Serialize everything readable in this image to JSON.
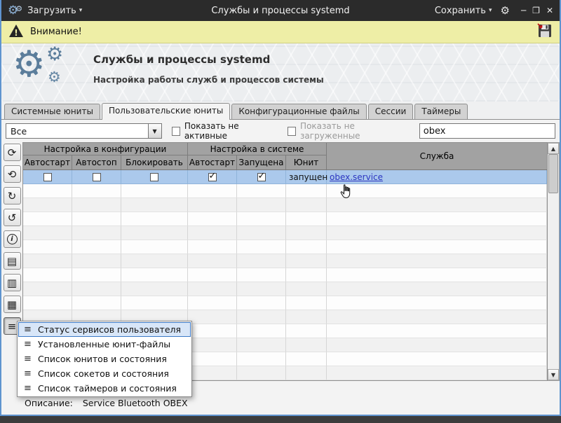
{
  "titlebar": {
    "app_icon": "⚙",
    "load_button": "Загрузить",
    "dropdown_arrow": "▾",
    "title": "Службы и процессы systemd",
    "save_button": "Сохранить",
    "settings_icon": "⚙",
    "minimize_icon": "─",
    "maximize_icon": "❐",
    "close_icon": "✕"
  },
  "warning_bar": {
    "text": "Внимание!"
  },
  "header": {
    "gear_icon": "⚙",
    "title": "Службы и процессы systemd",
    "subtitle": "Настройка работы служб и процессов системы"
  },
  "tabs": [
    {
      "label": "Системные юниты"
    },
    {
      "label": "Пользовательские юниты"
    },
    {
      "label": "Конфигурационные файлы"
    },
    {
      "label": "Сессии"
    },
    {
      "label": "Таймеры"
    }
  ],
  "filter_bar": {
    "unit_filter_value": "Все",
    "dropdown_arrow": "▼",
    "show_inactive_label": "Показать не активные",
    "show_unloaded_label": "Показать не загруженные",
    "search_value": "obex"
  },
  "toolbar": {
    "buttons": [
      {
        "name": "refresh",
        "glyph": "⟳"
      },
      {
        "name": "refresh-all",
        "glyph": "⟲"
      },
      {
        "name": "redo",
        "glyph": "↻"
      },
      {
        "name": "undo",
        "glyph": "↺"
      },
      {
        "name": "info",
        "glyph": "i"
      },
      {
        "name": "file",
        "glyph": "▤"
      },
      {
        "name": "journal",
        "glyph": "▥"
      },
      {
        "name": "list",
        "glyph": "▦"
      },
      {
        "name": "status-menu",
        "glyph": "≡"
      }
    ]
  },
  "table": {
    "group_config": "Настройка в конфигурации",
    "group_system": "Настройка в системе",
    "col_service": "Служба",
    "columns": [
      "Автостарт",
      "Автостоп",
      "Блокировать",
      "Автостарт",
      "Запущена",
      "Юнит"
    ],
    "row": {
      "config_autostart": false,
      "config_autostop": false,
      "config_block": false,
      "system_autostart": true,
      "system_running": true,
      "unit_status": "запущен",
      "service_link": "obex.service"
    }
  },
  "context_menu": {
    "item_icon": "≡",
    "items": [
      "Статус сервисов пользователя",
      "Установленные юнит-файлы",
      "Список юнитов и состояния",
      "Список сокетов и состояния",
      "Список таймеров и состояния"
    ]
  },
  "status_bar": {
    "label": "Описание:",
    "value": "Service Bluetooth OBEX"
  },
  "colors": {
    "selection": "#abc9ec",
    "link": "#2b35c0",
    "warning_bg": "#eeeea6",
    "window_border": "#5f94cf"
  }
}
